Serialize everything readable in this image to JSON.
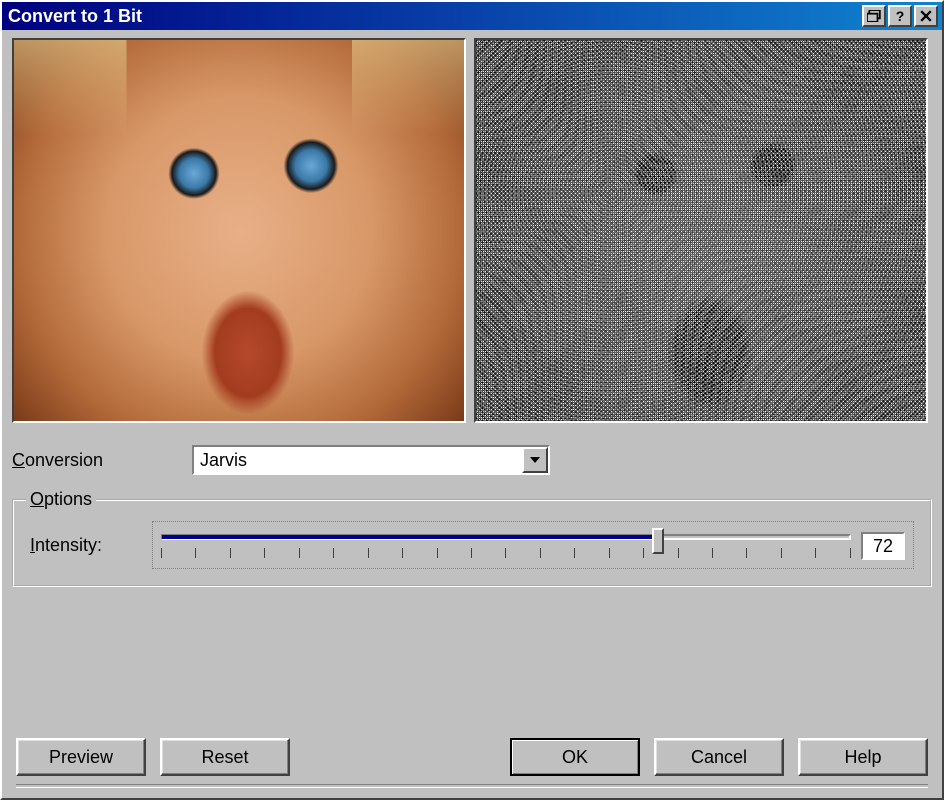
{
  "window": {
    "title": "Convert to 1 Bit"
  },
  "previews": {
    "original_desc": "original-image",
    "result_desc": "dithered-image"
  },
  "conversion": {
    "label_html": "<span class=\"underline\">C</span>onversion",
    "selected": "Jarvis"
  },
  "options": {
    "group_label_html": "<span class=\"underline\">O</span>ptions",
    "intensity_label_html": "<span class=\"underline\">I</span>ntensity:",
    "intensity_value": "72"
  },
  "buttons": {
    "preview": "Preview",
    "reset": "Reset",
    "ok": "OK",
    "cancel": "Cancel",
    "help": "Help"
  },
  "titlebar_icons": {
    "restore": "restore-icon",
    "help": "help-icon",
    "close": "close-icon"
  }
}
